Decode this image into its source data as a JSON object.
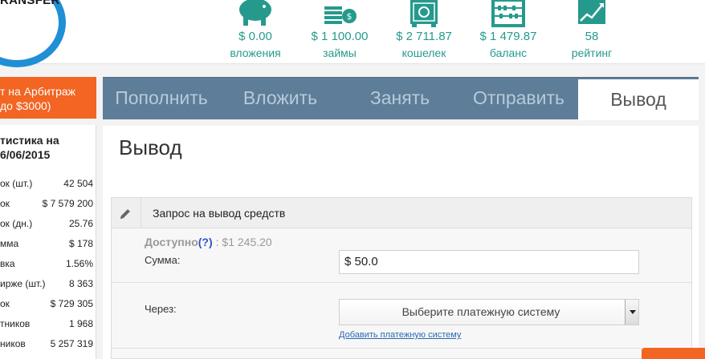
{
  "logo": {
    "text": "RANSFER"
  },
  "header_stats": [
    {
      "icon": "piggy-bank-icon",
      "value": "$ 0.00",
      "label": "вложения"
    },
    {
      "icon": "coins-stack-icon",
      "value": "$ 1 100.00",
      "label": "займы"
    },
    {
      "icon": "safe-icon",
      "value": "$ 2 711.87",
      "label": "кошелек"
    },
    {
      "icon": "abacus-icon",
      "value": "$ 1 479.87",
      "label": "баланс"
    },
    {
      "icon": "growth-chart-icon",
      "value": "58",
      "label": "рейтинг"
    }
  ],
  "promo": {
    "line1": "т на Арбитраж",
    "line2": "до $3000)"
  },
  "sidebar_stats": {
    "title_line1": "тистика на",
    "title_line2": "6/06/2015",
    "rows": [
      {
        "k": "ок (шт.)",
        "v": "42 504"
      },
      {
        "k": "ок",
        "v": "$ 7 579 200"
      },
      {
        "k": "ок (дн.)",
        "v": "25.76"
      },
      {
        "k": "мма",
        "v": "$ 178"
      },
      {
        "k": "вка",
        "v": "1.56%"
      },
      {
        "k": "ирже (шт.)",
        "v": "8 363"
      },
      {
        "k": "ок",
        "v": "$ 729 305"
      },
      {
        "k": "тников",
        "v": "1 968"
      },
      {
        "k": "ников",
        "v": "5 257 319"
      }
    ]
  },
  "tabs": [
    {
      "label": "Пополнить",
      "active": false
    },
    {
      "label": "Вложить",
      "active": false
    },
    {
      "label": "Занять",
      "active": false
    },
    {
      "label": "Отправить",
      "active": false
    },
    {
      "label": "Вывод",
      "active": true
    }
  ],
  "page": {
    "title": "Вывод"
  },
  "form": {
    "header_title": "Запрос на вывод средств",
    "available_label": "Доступно",
    "available_hint": "(?)",
    "available_amount": ": $1 245.20",
    "sum_label": "Сумма:",
    "sum_value": "$ 50.0",
    "via_label": "Через:",
    "via_select": "Выберите платежную систему",
    "add_link": "Добавить платежную систему"
  },
  "colors": {
    "accent_teal": "#259a8c",
    "tabs_bg": "#5e7d99",
    "promo_orange": "#f26522",
    "logo_blue": "#1f8fd6"
  }
}
